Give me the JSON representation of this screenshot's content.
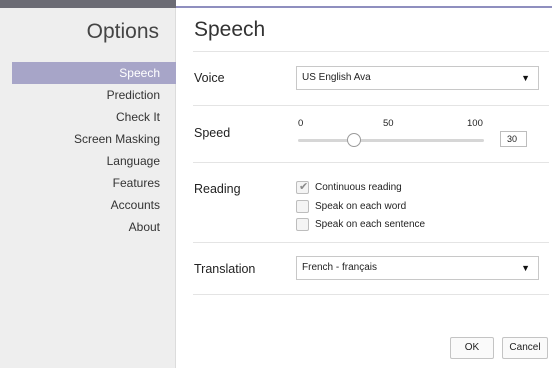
{
  "sidebar": {
    "title": "Options",
    "items": [
      {
        "label": "Speech",
        "selected": true
      },
      {
        "label": "Prediction"
      },
      {
        "label": "Check It"
      },
      {
        "label": "Screen Masking"
      },
      {
        "label": "Language"
      },
      {
        "label": "Features"
      },
      {
        "label": "Accounts"
      },
      {
        "label": "About"
      }
    ]
  },
  "main": {
    "title": "Speech",
    "voice": {
      "label": "Voice",
      "value": "US English Ava"
    },
    "speed": {
      "label": "Speed",
      "tick_min": "0",
      "tick_mid": "50",
      "tick_max": "100",
      "value": "30",
      "fraction": 0.3
    },
    "reading": {
      "label": "Reading",
      "options": [
        {
          "label": "Continuous reading",
          "checked": true
        },
        {
          "label": "Speak on each word",
          "checked": false
        },
        {
          "label": "Speak on each sentence",
          "checked": false
        }
      ]
    },
    "translation": {
      "label": "Translation",
      "value": "French - français"
    }
  },
  "buttons": {
    "ok": "OK",
    "cancel": "Cancel"
  },
  "icons": {
    "dropdown": "chevron-down-icon",
    "check": "checkmark-icon"
  },
  "colors": {
    "selected_bg": "#a7a5c8",
    "sidebar_bg": "#eeeeee",
    "accent": "#8f8fbf"
  }
}
